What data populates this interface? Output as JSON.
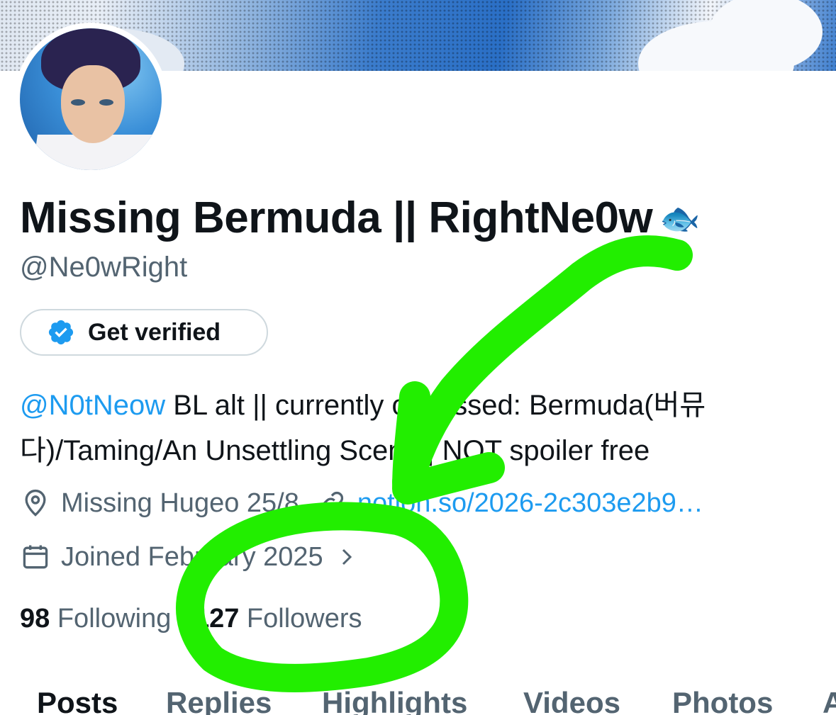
{
  "profile": {
    "display_name": "Missing Bermuda || RightNe0w",
    "name_emoji": "🐟",
    "handle": "@Ne0wRight",
    "verify_label": "Get verified",
    "bio_mention": "@N0tNeow",
    "bio_text": " BL alt || currently obsessed: Bermuda(버뮤다)/Taming/An Unsettling Scent || NOT spoiler free",
    "location": "Missing Hugeo 25/8",
    "website": "notion.so/2026-2c303e2b9…",
    "joined": "Joined February 2025",
    "following_count": "98",
    "following_label": "Following",
    "followers_count": "127",
    "followers_label": "Followers"
  },
  "tabs": [
    {
      "label": "Posts"
    },
    {
      "label": "Replies"
    },
    {
      "label": "Highlights"
    },
    {
      "label": "Videos"
    },
    {
      "label": "Photos"
    },
    {
      "label": "A"
    }
  ],
  "colors": {
    "accent": "#1d9bf0",
    "annotation": "#22ee00",
    "secondary_text": "#536471"
  }
}
